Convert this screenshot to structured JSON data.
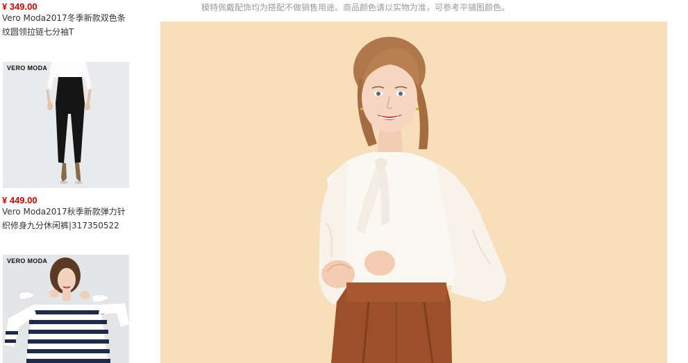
{
  "sidebar": {
    "items": [
      {
        "price": "¥ 349.00",
        "title": "Vero Moda2017冬季新款双色条纹圆领拉链七分袖T",
        "icon": "product-thumbnail"
      },
      {
        "brand": "VERO MODA",
        "price": "¥ 449.00",
        "title": "Vero Moda2017秋季新款弹力针织修身九分休闲裤|317350522",
        "icon": "product-thumbnail"
      },
      {
        "brand": "VERO MODA",
        "icon": "product-thumbnail"
      }
    ]
  },
  "main": {
    "notice": "模特佩戴配饰均为搭配不做销售用途。商品颜色请以实物为准，可参考平铺图颜色。",
    "hero_icon": "model-photo",
    "colors": {
      "background": "#f6dfba",
      "price": "#cc0000",
      "blouse": "#fbf7f1",
      "skirt": "#9c4f28"
    }
  }
}
